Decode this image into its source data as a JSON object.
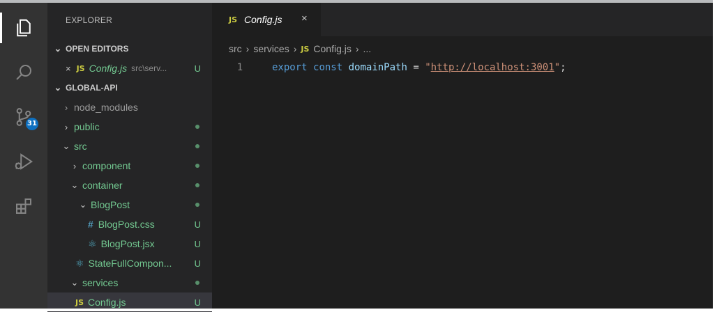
{
  "sidebar": {
    "title": "EXPLORER",
    "open_editors_header": "OPEN EDITORS",
    "open_editor": {
      "close": "×",
      "icon": "JS",
      "name": "Config.js",
      "path": "src\\serv...",
      "status": "U"
    },
    "project_header": "GLOBAL-API",
    "tree": [
      {
        "label": "node_modules",
        "chevron": "›"
      },
      {
        "label": "public",
        "chevron": "›"
      },
      {
        "label": "src",
        "chevron": "⌄"
      },
      {
        "label": "component",
        "chevron": "›"
      },
      {
        "label": "container",
        "chevron": "⌄"
      },
      {
        "label": "BlogPost",
        "chevron": "⌄"
      },
      {
        "label": "BlogPost.css",
        "icon": "#",
        "status": "U"
      },
      {
        "label": "BlogPost.jsx",
        "icon": "⚛",
        "status": "U"
      },
      {
        "label": "StateFullCompon...",
        "icon": "⚛",
        "status": "U"
      },
      {
        "label": "services",
        "chevron": "⌄"
      },
      {
        "label": "Config.js",
        "icon": "JS",
        "status": "U"
      }
    ]
  },
  "activity": {
    "scm_badge": "31"
  },
  "editor": {
    "tab": {
      "icon": "JS",
      "label": "Config.js",
      "close": "×"
    },
    "breadcrumb": {
      "part1": "src",
      "part2": "services",
      "icon": "JS",
      "file": "Config.js",
      "ellipsis": "..."
    },
    "line_number": "1",
    "code": {
      "kw1": "export",
      "kw2": "const",
      "name": "domainPath",
      "op": "=",
      "q1": "\"",
      "url": "http://localhost:3001",
      "q2": "\"",
      "semi": ";"
    }
  },
  "colors": {
    "accent": "#0e70c0",
    "untracked": "#73c991",
    "js": "#cbcb41",
    "string": "#ce9178",
    "keyword": "#569cd6"
  }
}
